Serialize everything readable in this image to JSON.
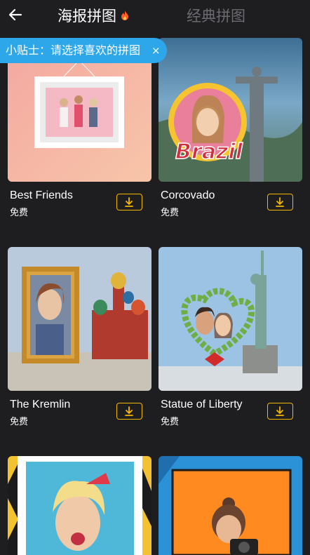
{
  "header": {
    "tab_poster": "海报拼图",
    "tab_classic": "经典拼图",
    "back_icon": "arrow-left-icon",
    "fire_icon": "fire-icon"
  },
  "tip": {
    "text": "小贴士：请选择喜欢的拼图",
    "close": "×"
  },
  "cards": [
    {
      "title": "Best Friends",
      "price": "免费",
      "download_icon": "download-icon"
    },
    {
      "title": "Corcovado",
      "price": "免费",
      "badge_text": "Brazil",
      "download_icon": "download-icon"
    },
    {
      "title": "The Kremlin",
      "price": "免费",
      "download_icon": "download-icon"
    },
    {
      "title": "Statue of Liberty",
      "price": "免费",
      "download_icon": "download-icon"
    }
  ],
  "colors": {
    "background": "#1e1e21",
    "tip_bg": "#2ea7ea",
    "download_accent": "#f5b800",
    "inactive_tab": "#6c6c70"
  }
}
